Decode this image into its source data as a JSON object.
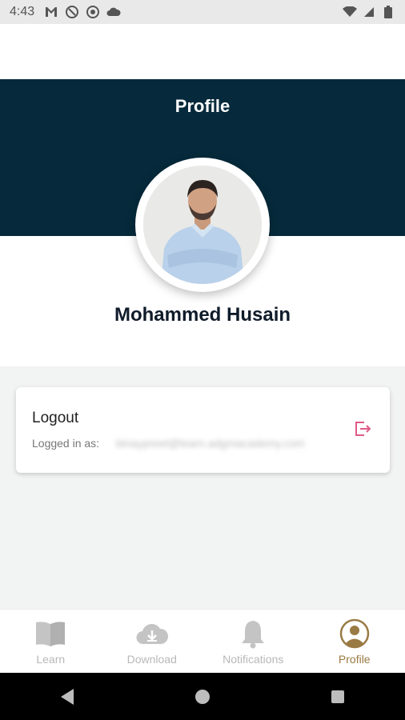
{
  "status_bar": {
    "time": "4:43",
    "left_icons": [
      "gmail-icon",
      "do-not-disturb-icon",
      "target-icon",
      "cloud-icon"
    ],
    "right_icons": [
      "wifi-icon",
      "signal-icon",
      "battery-icon"
    ]
  },
  "header": {
    "title": "Profile",
    "background_color": "#062a3b"
  },
  "profile": {
    "name": "Mohammed Husain"
  },
  "logout_card": {
    "title": "Logout",
    "logged_in_label": "Logged in as:",
    "email": "binaypreet@learn.adgmacademy.com",
    "icon": "logout-icon",
    "icon_color": "#e05a87"
  },
  "bottom_nav": {
    "items": [
      {
        "label": "Learn",
        "icon": "book-icon",
        "active": false
      },
      {
        "label": "Download",
        "icon": "cloud-download-icon",
        "active": false
      },
      {
        "label": "Notifications",
        "icon": "bell-icon",
        "active": false
      },
      {
        "label": "Profile",
        "icon": "user-icon",
        "active": true
      }
    ],
    "active_color": "#9a7a44",
    "inactive_color": "#b8b8b8"
  },
  "android_nav": {
    "buttons": [
      "back-icon",
      "home-icon",
      "recents-icon"
    ]
  }
}
